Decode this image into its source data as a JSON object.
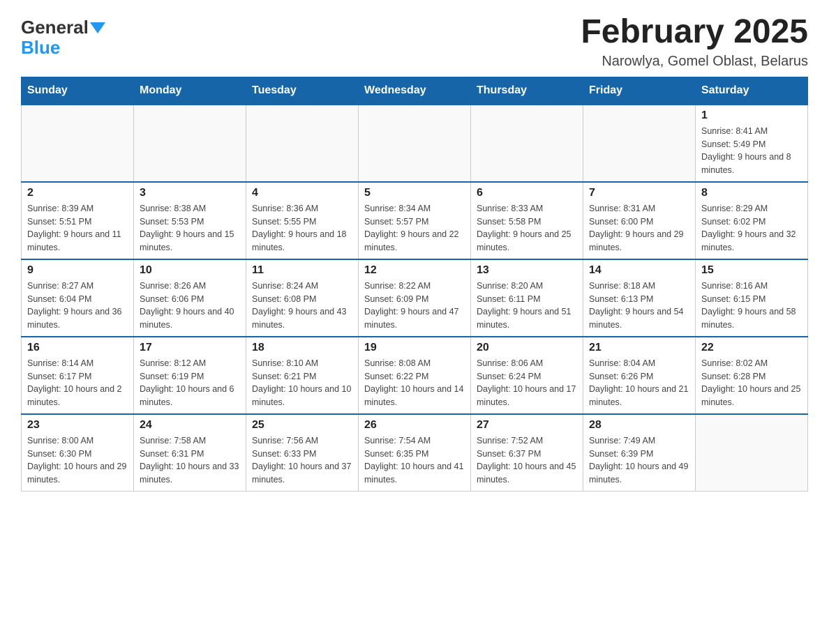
{
  "header": {
    "logo": {
      "general": "General",
      "blue": "Blue",
      "arrow": "▲"
    },
    "title": "February 2025",
    "subtitle": "Narowlya, Gomel Oblast, Belarus"
  },
  "days_of_week": [
    "Sunday",
    "Monday",
    "Tuesday",
    "Wednesday",
    "Thursday",
    "Friday",
    "Saturday"
  ],
  "weeks": [
    [
      {
        "day": "",
        "info": ""
      },
      {
        "day": "",
        "info": ""
      },
      {
        "day": "",
        "info": ""
      },
      {
        "day": "",
        "info": ""
      },
      {
        "day": "",
        "info": ""
      },
      {
        "day": "",
        "info": ""
      },
      {
        "day": "1",
        "info": "Sunrise: 8:41 AM\nSunset: 5:49 PM\nDaylight: 9 hours and 8 minutes."
      }
    ],
    [
      {
        "day": "2",
        "info": "Sunrise: 8:39 AM\nSunset: 5:51 PM\nDaylight: 9 hours and 11 minutes."
      },
      {
        "day": "3",
        "info": "Sunrise: 8:38 AM\nSunset: 5:53 PM\nDaylight: 9 hours and 15 minutes."
      },
      {
        "day": "4",
        "info": "Sunrise: 8:36 AM\nSunset: 5:55 PM\nDaylight: 9 hours and 18 minutes."
      },
      {
        "day": "5",
        "info": "Sunrise: 8:34 AM\nSunset: 5:57 PM\nDaylight: 9 hours and 22 minutes."
      },
      {
        "day": "6",
        "info": "Sunrise: 8:33 AM\nSunset: 5:58 PM\nDaylight: 9 hours and 25 minutes."
      },
      {
        "day": "7",
        "info": "Sunrise: 8:31 AM\nSunset: 6:00 PM\nDaylight: 9 hours and 29 minutes."
      },
      {
        "day": "8",
        "info": "Sunrise: 8:29 AM\nSunset: 6:02 PM\nDaylight: 9 hours and 32 minutes."
      }
    ],
    [
      {
        "day": "9",
        "info": "Sunrise: 8:27 AM\nSunset: 6:04 PM\nDaylight: 9 hours and 36 minutes."
      },
      {
        "day": "10",
        "info": "Sunrise: 8:26 AM\nSunset: 6:06 PM\nDaylight: 9 hours and 40 minutes."
      },
      {
        "day": "11",
        "info": "Sunrise: 8:24 AM\nSunset: 6:08 PM\nDaylight: 9 hours and 43 minutes."
      },
      {
        "day": "12",
        "info": "Sunrise: 8:22 AM\nSunset: 6:09 PM\nDaylight: 9 hours and 47 minutes."
      },
      {
        "day": "13",
        "info": "Sunrise: 8:20 AM\nSunset: 6:11 PM\nDaylight: 9 hours and 51 minutes."
      },
      {
        "day": "14",
        "info": "Sunrise: 8:18 AM\nSunset: 6:13 PM\nDaylight: 9 hours and 54 minutes."
      },
      {
        "day": "15",
        "info": "Sunrise: 8:16 AM\nSunset: 6:15 PM\nDaylight: 9 hours and 58 minutes."
      }
    ],
    [
      {
        "day": "16",
        "info": "Sunrise: 8:14 AM\nSunset: 6:17 PM\nDaylight: 10 hours and 2 minutes."
      },
      {
        "day": "17",
        "info": "Sunrise: 8:12 AM\nSunset: 6:19 PM\nDaylight: 10 hours and 6 minutes."
      },
      {
        "day": "18",
        "info": "Sunrise: 8:10 AM\nSunset: 6:21 PM\nDaylight: 10 hours and 10 minutes."
      },
      {
        "day": "19",
        "info": "Sunrise: 8:08 AM\nSunset: 6:22 PM\nDaylight: 10 hours and 14 minutes."
      },
      {
        "day": "20",
        "info": "Sunrise: 8:06 AM\nSunset: 6:24 PM\nDaylight: 10 hours and 17 minutes."
      },
      {
        "day": "21",
        "info": "Sunrise: 8:04 AM\nSunset: 6:26 PM\nDaylight: 10 hours and 21 minutes."
      },
      {
        "day": "22",
        "info": "Sunrise: 8:02 AM\nSunset: 6:28 PM\nDaylight: 10 hours and 25 minutes."
      }
    ],
    [
      {
        "day": "23",
        "info": "Sunrise: 8:00 AM\nSunset: 6:30 PM\nDaylight: 10 hours and 29 minutes."
      },
      {
        "day": "24",
        "info": "Sunrise: 7:58 AM\nSunset: 6:31 PM\nDaylight: 10 hours and 33 minutes."
      },
      {
        "day": "25",
        "info": "Sunrise: 7:56 AM\nSunset: 6:33 PM\nDaylight: 10 hours and 37 minutes."
      },
      {
        "day": "26",
        "info": "Sunrise: 7:54 AM\nSunset: 6:35 PM\nDaylight: 10 hours and 41 minutes."
      },
      {
        "day": "27",
        "info": "Sunrise: 7:52 AM\nSunset: 6:37 PM\nDaylight: 10 hours and 45 minutes."
      },
      {
        "day": "28",
        "info": "Sunrise: 7:49 AM\nSunset: 6:39 PM\nDaylight: 10 hours and 49 minutes."
      },
      {
        "day": "",
        "info": ""
      }
    ]
  ]
}
